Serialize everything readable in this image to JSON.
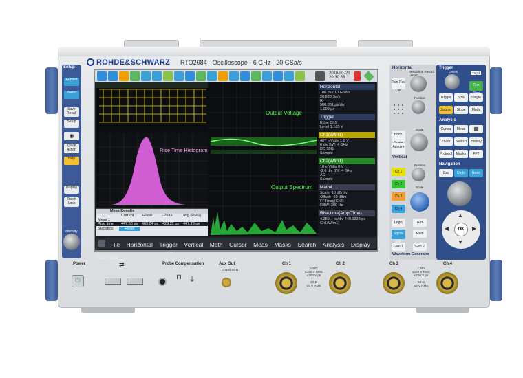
{
  "header": {
    "brand": "ROHDE&SCHWARZ",
    "model": "RTO2084 · Oscilloscope · 6 GHz · 20 GSa/s"
  },
  "left_panel": {
    "title": "Setup",
    "buttons": [
      "Autoset",
      "Preset",
      "Save Recall",
      "Setup",
      "Quick Action",
      "Help",
      "Display",
      "Touch Lock"
    ],
    "knob_label": "Intensity"
  },
  "screen": {
    "clock": [
      "2016-01-21",
      "20:30:53"
    ],
    "top_panel": {
      "title": "Rise Time Histogram"
    },
    "upper_right_panel": {
      "title": "Output Voltage"
    },
    "lower_right_panel": {
      "title": "Output Spectrum"
    },
    "meas": {
      "title": "Meas Results",
      "columns": [
        "Current",
        "+Peak",
        "-Peak",
        "avg (RMS)"
      ],
      "rows": [
        {
          "label": "Meas 1",
          "values": [
            "",
            "",
            "",
            ""
          ]
        },
        {
          "label": "Rise time",
          "values": [
            "447.60 ps",
            "469.04 ps",
            "429.22 ps",
            "447.29 ps"
          ]
        }
      ],
      "footer": "Statistics:",
      "reset": "Reset"
    },
    "sidebar": [
      {
        "head": "Horizontal",
        "lines": [
          "100 ps / 10 GSa/s",
          "20.833 Sa/s",
          "R",
          "500.061 ps/div",
          "1.009 µs"
        ],
        "color": "#2b3a5c"
      },
      {
        "head": "Trigger",
        "lines": [
          "Edge  Ch1",
          "Level 1.185 V"
        ],
        "color": "#2b3a5c"
      },
      {
        "head": "Ch1(Wfm1)",
        "lines": [
          "487 mV/div   1.9 V",
          "0 div        BW: 4 GHz",
          "DC 50Ω",
          "Sample"
        ],
        "color": "#b8a600"
      },
      {
        "head": "Ch2(Wfm1)",
        "lines": [
          "10 mV/div    0 V",
          "-2.6 div     BW: 4 GHz",
          "AC",
          "Sample"
        ],
        "color": "#2a8a2a"
      },
      {
        "head": "Math4",
        "lines": [
          "Scale: 10 dB/div",
          "Offset: -60 dBm",
          "FFTmag(Ch2)",
          "RBW: 300 Hz"
        ],
        "color": "#3c3c50"
      },
      {
        "head": "Rise time(Amp/Time)",
        "lines": [
          "4.289... ps/div  449.1238 ps",
          "Ch1(Wfm1)"
        ],
        "color": "#3c3c50"
      }
    ],
    "menu": [
      "File",
      "Horizontal",
      "Trigger",
      "Vertical",
      "Math",
      "Cursor",
      "Meas",
      "Masks",
      "Search",
      "Analysis",
      "Display",
      "Tutorials"
    ]
  },
  "right_panel": {
    "horizontal": {
      "title": "Horizontal",
      "knob_label": "Resolution Record Length",
      "buttons": [
        "Run Rec Len",
        "Position",
        "Horiz. Scale",
        "Acquire"
      ],
      "scale_label": "Scale"
    },
    "trigger": {
      "title": "Trigger",
      "buttons": [
        "Run Stop",
        "Single",
        "Trigger",
        "50%",
        "Source",
        "Slope",
        "Mode"
      ],
      "levels_label": "Levels",
      "trig_d": "Trig'd"
    },
    "vertical": {
      "title": "Vertical",
      "buttons": [
        "Ch 1",
        "Ch 2",
        "Ch 3",
        "Ch 4",
        "Logic",
        "Signal Off",
        "Ref",
        "Math",
        "Gen 1",
        "Gen 2"
      ],
      "position_label": "Position",
      "scale_label": "Scale"
    },
    "analysis": {
      "title": "Analysis",
      "buttons": [
        "Cursor",
        "Meas",
        "Zoom",
        "Search",
        "Protocol",
        "Masks",
        "History",
        "FFT"
      ]
    },
    "navigation": {
      "title": "Navigation",
      "buttons": [
        "Esc",
        "Undo",
        "Redo",
        "OK"
      ]
    },
    "waveform_gen": "Waveform Generator"
  },
  "bottom": {
    "power": "Power",
    "probe": "Probe Compensation",
    "aux": "Aux Out",
    "aux_sub": "Output 50 Ω",
    "channels": [
      "Ch 1",
      "Ch 2",
      "Ch 3",
      "Ch 4"
    ],
    "spec_left": "1 MΩ\n≤150 V RMS\n≤200 V pk\n\n50 Ω\n≤5 V RMS",
    "spec_right": "1 MΩ\n≤150 V RMS\n≤200 V pk\n\n50 Ω\n≤5 V RMS"
  },
  "colors": {
    "bumper": "#3d5a8f",
    "brand": "#1a3d8f",
    "ch1": "#e8e000",
    "ch2": "#2ecc40",
    "histogram": "#e766e7"
  }
}
